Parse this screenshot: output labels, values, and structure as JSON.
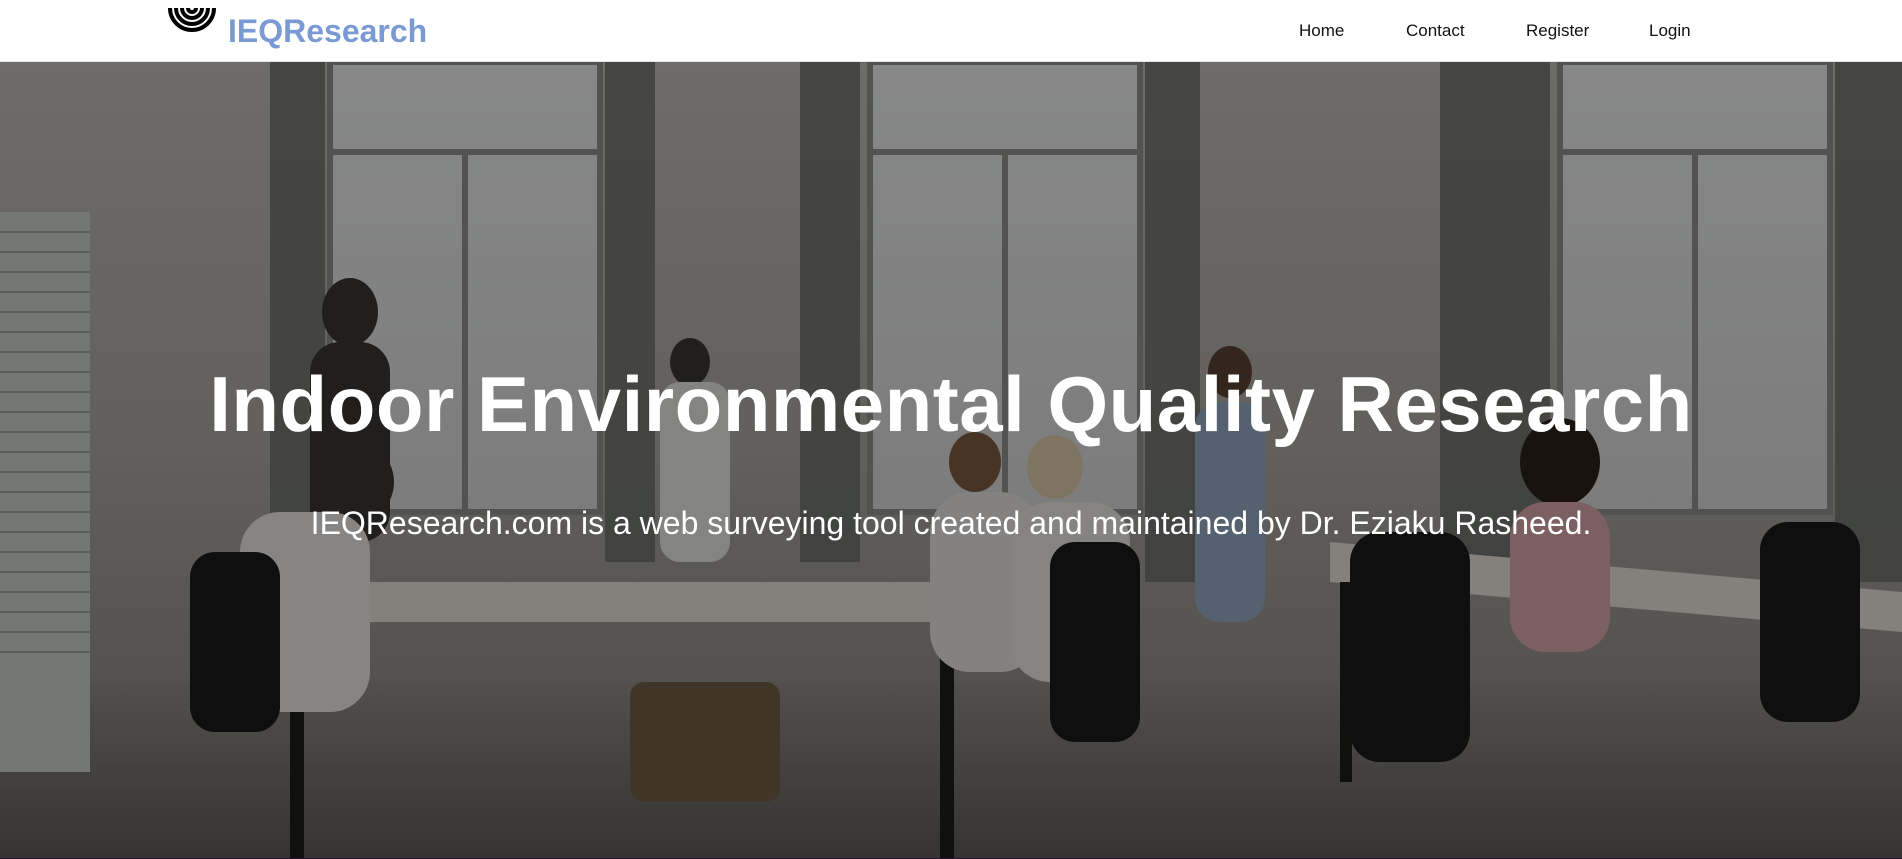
{
  "header": {
    "brand_name": "IEQResearch",
    "brand_color": "#7a9ad3",
    "logo_icon": "concentric-arcs-icon"
  },
  "nav": {
    "items": [
      {
        "label": "Home"
      },
      {
        "label": "Contact"
      },
      {
        "label": "Register"
      },
      {
        "label": "Login"
      }
    ]
  },
  "hero": {
    "title": "Indoor Environmental Quality Research",
    "subtitle": "IEQResearch.com is a web surveying tool created and maintained by Dr. Eziaku Rasheed.",
    "background_image": "open-plan-office-photo"
  }
}
